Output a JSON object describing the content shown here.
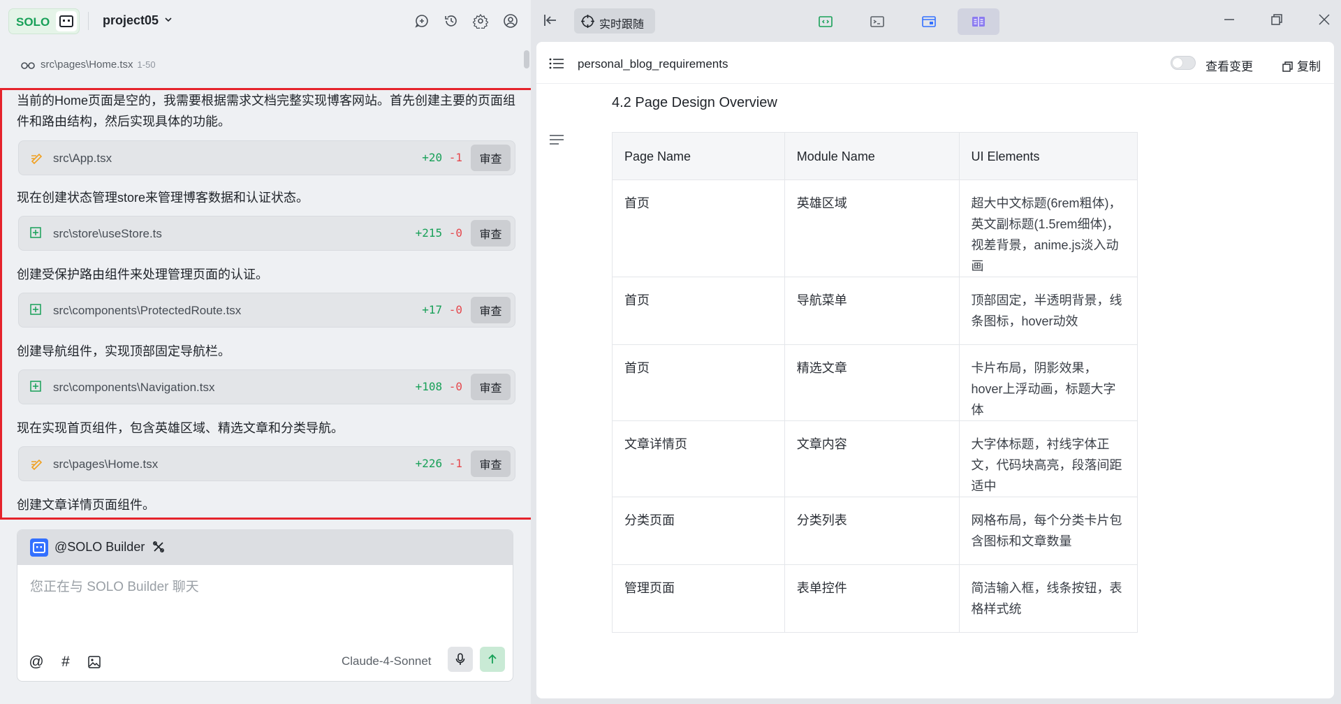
{
  "brand": {
    "label": "SOLO"
  },
  "project": {
    "name": "project05"
  },
  "file_ref": {
    "path": "src\\pages\\Home.tsx",
    "range": "1-50"
  },
  "chat": {
    "messages": [
      "当前的Home页面是空的，我需要根据需求文档完整实现博客网站。首先创建主要的页面组件和路由结构，然后实现具体的功能。",
      "现在创建状态管理store来管理博客数据和认证状态。",
      "创建受保护路由组件来处理管理页面的认证。",
      "创建导航组件，实现顶部固定导航栏。",
      "现在实现首页组件，包含英雄区域、精选文章和分类导航。",
      "创建文章详情页面组件。"
    ],
    "files": [
      {
        "name": "src\\App.tsx",
        "add": "+20",
        "del": "-1",
        "review": "审查",
        "icon": "edit-icon"
      },
      {
        "name": "src\\store\\useStore.ts",
        "add": "+215",
        "del": "-0",
        "review": "审查",
        "icon": "new-file-icon"
      },
      {
        "name": "src\\components\\ProtectedRoute.tsx",
        "add": "+17",
        "del": "-0",
        "review": "审查",
        "icon": "new-file-icon"
      },
      {
        "name": "src\\components\\Navigation.tsx",
        "add": "+108",
        "del": "-0",
        "review": "审查",
        "icon": "new-file-icon"
      },
      {
        "name": "src\\pages\\Home.tsx",
        "add": "+226",
        "del": "-1",
        "review": "审查",
        "icon": "edit-icon"
      }
    ]
  },
  "composer": {
    "agent": "@SOLO Builder",
    "placeholder": "您正在与 SOLO Builder 聊天",
    "model": "Claude-4-Sonnet"
  },
  "right_toolbar": {
    "track_label": "实时跟随"
  },
  "doc": {
    "title": "personal_blog_requirements",
    "view_changes": "查看变更",
    "copy": "复制",
    "section_heading": "4.2 Page Design Overview",
    "table": {
      "headers": [
        "Page Name",
        "Module Name",
        "UI Elements"
      ],
      "rows": [
        [
          "首页",
          "英雄区域",
          "超大中文标题(6rem粗体)，英文副标题(1.5rem细体)，视差背景，anime.js淡入动画"
        ],
        [
          "首页",
          "导航菜单",
          "顶部固定，半透明背景，线条图标，hover动效"
        ],
        [
          "首页",
          "精选文章",
          "卡片布局，阴影效果，hover上浮动画，标题大字体"
        ],
        [
          "文章详情页",
          "文章内容",
          "大字体标题，衬线字体正文，代码块高亮，段落间距适中"
        ],
        [
          "分类页面",
          "分类列表",
          "网格布局，每个分类卡片包含图标和文章数量"
        ],
        [
          "管理页面",
          "表单控件",
          "简洁输入框，线条按钮，表格样式统"
        ]
      ]
    }
  },
  "colors": {
    "accent_green": "#18a058",
    "danger_red": "#e5484d",
    "highlight_border": "#e5232b",
    "primary_blue": "#3370ff"
  }
}
